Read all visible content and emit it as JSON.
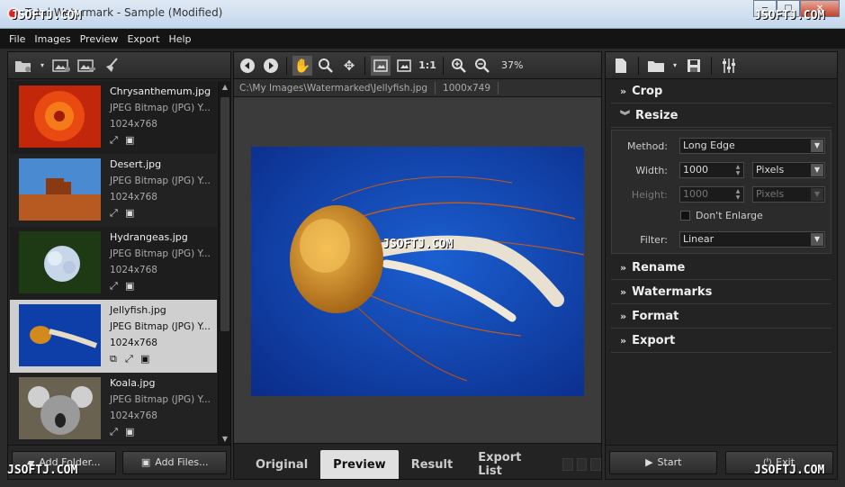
{
  "window": {
    "title": "Total Watermark - Sample (Modified)",
    "min": "─",
    "max": "□",
    "close": "✕"
  },
  "menu": [
    "File",
    "Images",
    "Preview",
    "Export",
    "Help"
  ],
  "files": [
    {
      "name": "Chrysanthemum.jpg",
      "type": "JPEG Bitmap (JPG) Y...",
      "dims": "1024x768"
    },
    {
      "name": "Desert.jpg",
      "type": "JPEG Bitmap (JPG) Y...",
      "dims": "1024x768"
    },
    {
      "name": "Hydrangeas.jpg",
      "type": "JPEG Bitmap (JPG) Y...",
      "dims": "1024x768"
    },
    {
      "name": "Jellyfish.jpg",
      "type": "JPEG Bitmap (JPG) Y...",
      "dims": "1024x768"
    },
    {
      "name": "Koala.jpg",
      "type": "JPEG Bitmap (JPG) Y...",
      "dims": "1024x768"
    }
  ],
  "left_buttons": {
    "add_folder": "Add Folder...",
    "add_files": "Add Files..."
  },
  "center": {
    "zoom": "37%",
    "one_to_one": "1:1",
    "path": "C:\\My Images\\Watermarked\\Jellyfish.jpg",
    "image_size": "1000x749",
    "tabs": [
      "Original",
      "Preview",
      "Result",
      "Export List"
    ],
    "active_tab": "Preview"
  },
  "right": {
    "sections": {
      "crop": "Crop",
      "resize": "Resize",
      "rename": "Rename",
      "watermarks": "Watermarks",
      "format": "Format",
      "export": "Export"
    },
    "resize": {
      "method_label": "Method:",
      "method_value": "Long Edge",
      "width_label": "Width:",
      "width_value": "1000",
      "width_unit": "Pixels",
      "height_label": "Height:",
      "height_value": "1000",
      "height_unit": "Pixels",
      "dont_enlarge": "Don't Enlarge",
      "filter_label": "Filter:",
      "filter_value": "Linear"
    },
    "start": "Start",
    "exit": "Exit"
  },
  "watermark_text": "JSOFTJ.COM",
  "colors": {
    "accent_selected": "#cfcfcf",
    "panel_bg": "#232323",
    "close_button": "#c2432c"
  }
}
